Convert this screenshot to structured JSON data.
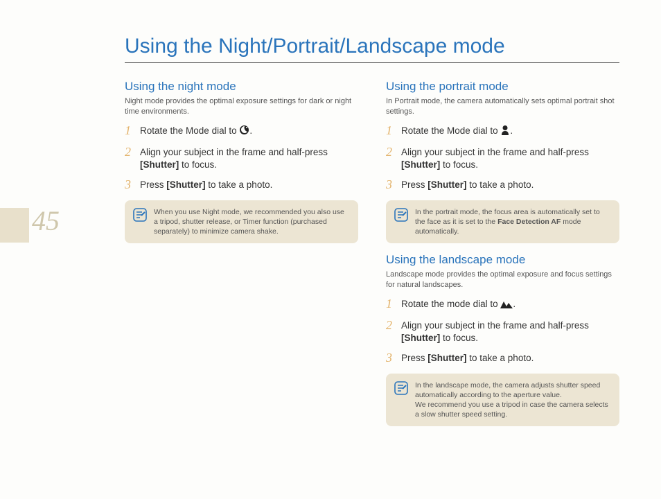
{
  "pageNumber": "45",
  "mainTitle": "Using the Night/Portrait/Landscape mode",
  "left": {
    "night": {
      "heading": "Using the night mode",
      "lead": "Night mode provides the optimal exposure settings for dark or night time environments.",
      "step1a": "Rotate the Mode dial to ",
      "step1b": ".",
      "step2a": "Align your subject in the frame and half-press ",
      "step2b": "[Shutter]",
      "step2c": " to focus.",
      "step3a": "Press ",
      "step3b": "[Shutter]",
      "step3c": " to take a photo.",
      "note": "When you use Night mode, we recommended you also use a tripod, shutter release, or Timer function (purchased separately) to minimize camera shake."
    }
  },
  "right": {
    "portrait": {
      "heading": "Using the portrait mode",
      "lead": "In Portrait mode, the camera automatically sets optimal portrait shot settings.",
      "step1a": "Rotate the Mode dial to ",
      "step1b": ".",
      "step2a": "Align your subject in the frame and half-press ",
      "step2b": "[Shutter]",
      "step2c": " to focus.",
      "step3a": "Press ",
      "step3b": "[Shutter]",
      "step3c": " to take a photo.",
      "note_a": "In the portrait mode, the focus area is automatically set to the face as it is set to the ",
      "note_b": "Face Detection AF",
      "note_c": " mode automatically."
    },
    "landscape": {
      "heading": "Using the landscape mode",
      "lead": "Landscape mode provides the optimal exposure and focus settings for natural landscapes.",
      "step1a": "Rotate the mode dial to ",
      "step1b": ".",
      "step2a": "Align your subject in the frame and half-press ",
      "step2b": "[Shutter]",
      "step2c": " to focus.",
      "step3a": "Press ",
      "step3b": "[Shutter]",
      "step3c": " to take a photo.",
      "note": "In the landscape mode, the camera adjusts shutter speed automatically according to the aperture value.\nWe recommend you use a tripod in case the camera selects a slow shutter speed setting."
    }
  },
  "steps": {
    "n1": "1",
    "n2": "2",
    "n3": "3"
  }
}
